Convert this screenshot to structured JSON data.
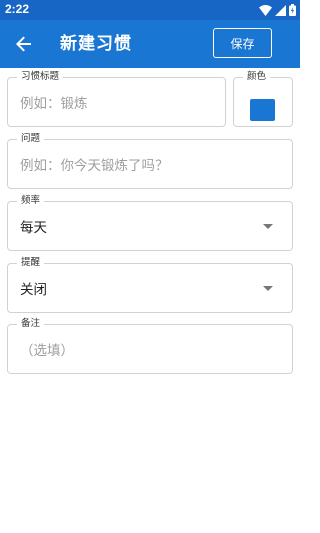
{
  "status_bar": {
    "time": "2:22"
  },
  "app_bar": {
    "title": "新建习惯",
    "save_label": "保存",
    "back_icon": "arrow-back-icon",
    "background": "#1976d2"
  },
  "form": {
    "habit_title": {
      "label": "习惯标题",
      "placeholder": "例如：锻炼"
    },
    "color": {
      "label": "颜色",
      "value": "#1976d2"
    },
    "question": {
      "label": "问题",
      "placeholder": "例如：你今天锻炼了吗？"
    },
    "frequency": {
      "label": "频率",
      "selected": "每天"
    },
    "reminder": {
      "label": "提醒",
      "selected": "关闭"
    },
    "notes": {
      "label": "备注",
      "placeholder": "（选填）"
    }
  }
}
